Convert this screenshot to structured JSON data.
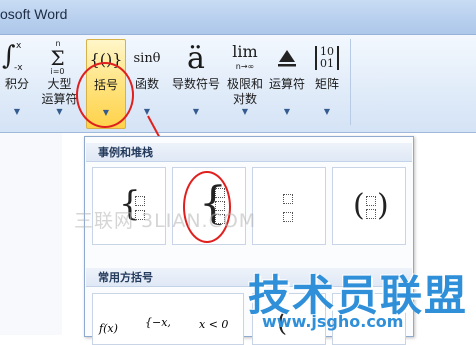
{
  "window": {
    "title": "osoft Word"
  },
  "ribbon": {
    "items": [
      {
        "label": "积分",
        "label2": "",
        "icon": "integral-icon"
      },
      {
        "label": "大型",
        "label2": "运算符",
        "icon": "sum-icon"
      },
      {
        "label": "括号",
        "label2": "",
        "icon": "bracket-icon",
        "glyph": "{()}"
      },
      {
        "label": "函数",
        "label2": "",
        "icon": "function-icon",
        "glyph": "sinθ"
      },
      {
        "label": "导数符号",
        "label2": "",
        "icon": "accent-icon",
        "glyph": "ä"
      },
      {
        "label": "极限和",
        "label2": "对数",
        "icon": "limit-icon",
        "glyph": "lim"
      },
      {
        "label": "运算符",
        "label2": "",
        "icon": "operator-icon"
      },
      {
        "label": "矩阵",
        "label2": "",
        "icon": "matrix-icon"
      }
    ],
    "integral_sub": "-x",
    "integral_sup": "x",
    "sum_sub": "i=0",
    "sum_sup": "n",
    "limit_sub": "n→∞",
    "matrix_top": "10",
    "matrix_bottom": "01",
    "active_color": "#ffd24a"
  },
  "panel": {
    "section1": "事例和堆栈",
    "section2": "常用方括号",
    "bottom_row": [
      "f(x)",
      "{−x,",
      "x < 0"
    ]
  },
  "watermarks": {
    "wm1": "三联网 3LIAN.COM",
    "wm2": "技术员联盟",
    "wm3": "www.jsgho.com"
  }
}
